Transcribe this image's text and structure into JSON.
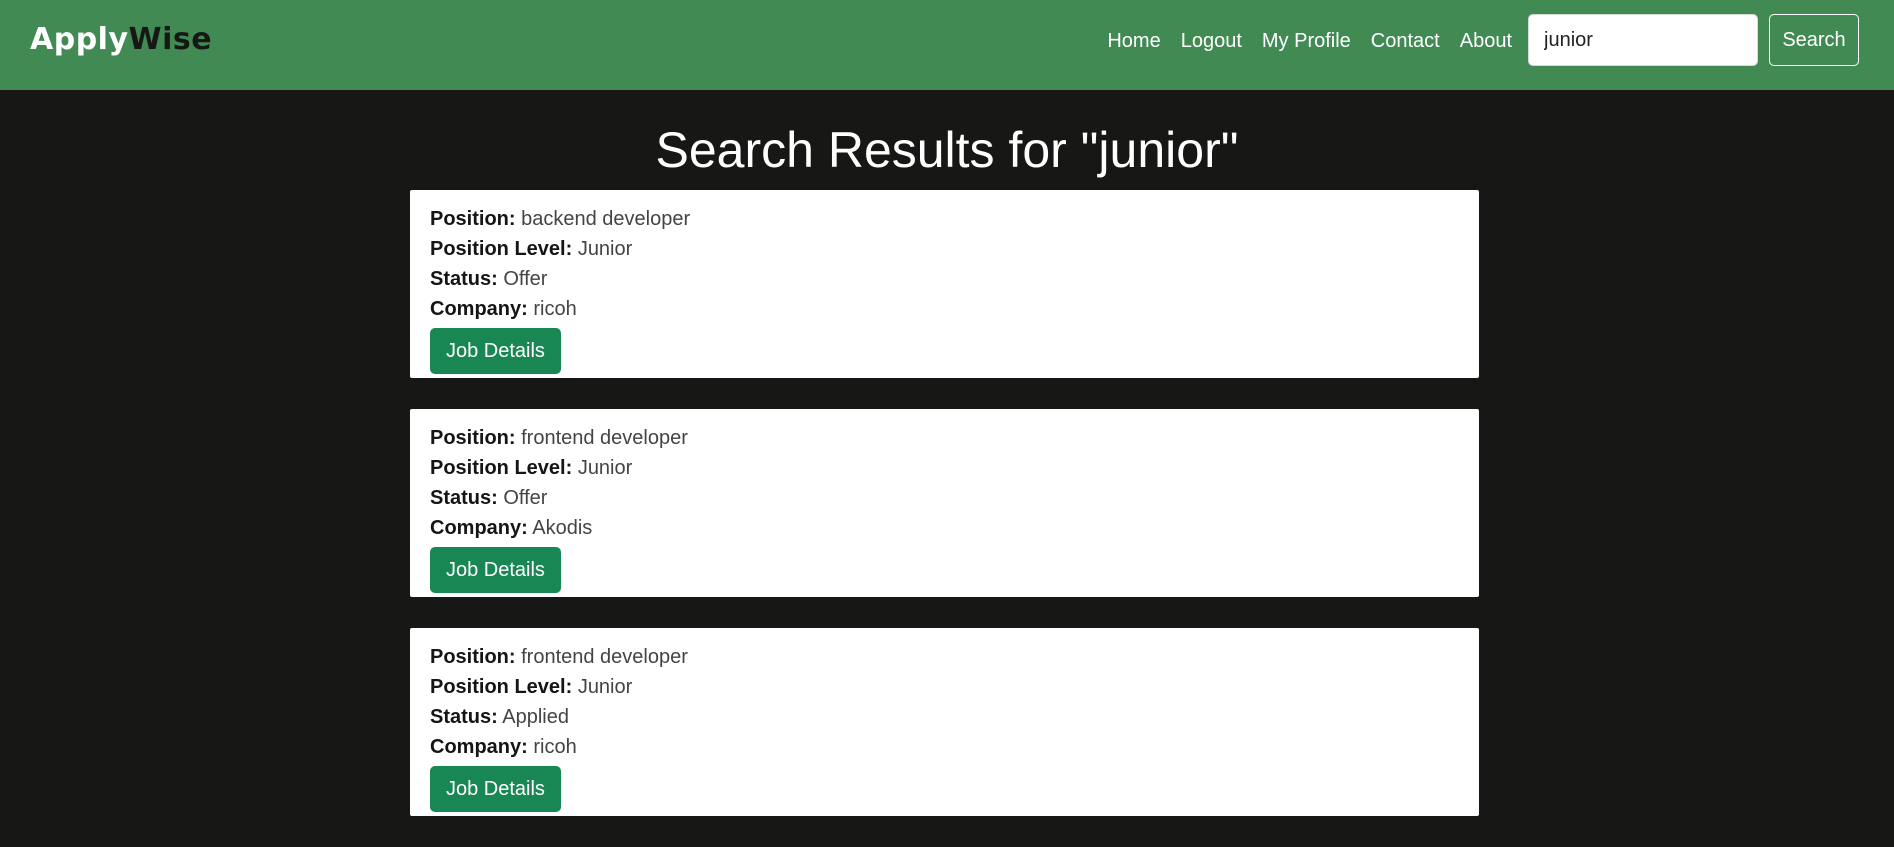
{
  "header": {
    "brand_part1": "Apply",
    "brand_part2": "Wise",
    "nav": [
      "Home",
      "Logout",
      "My Profile",
      "Contact",
      "About"
    ],
    "search_value": "junior",
    "search_button": "Search"
  },
  "main": {
    "title": "Search Results for \"junior\"",
    "labels": {
      "position": "Position:",
      "level": "Position Level:",
      "status": "Status:",
      "company": "Company:"
    },
    "details_button": "Job Details",
    "results": [
      {
        "position": "backend developer",
        "level": "Junior",
        "status": "Offer",
        "company": "ricoh"
      },
      {
        "position": "frontend developer",
        "level": "Junior",
        "status": "Offer",
        "company": "Akodis"
      },
      {
        "position": "frontend developer",
        "level": "Junior",
        "status": "Applied",
        "company": "ricoh"
      }
    ]
  },
  "colors": {
    "navbar": "#428a54",
    "background": "#171816",
    "button": "#198754"
  }
}
